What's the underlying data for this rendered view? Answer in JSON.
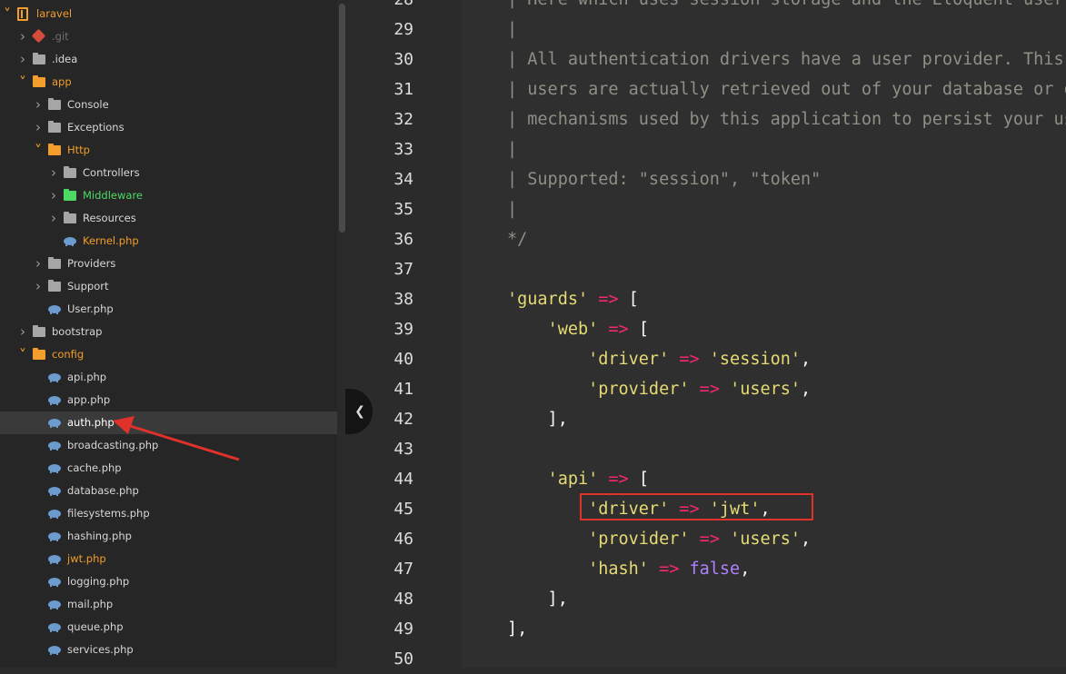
{
  "sidebar": {
    "items": [
      {
        "label": "laravel",
        "icon": "repo-icon",
        "depth": 0,
        "arrow": "open",
        "style": "orange"
      },
      {
        "label": ".git",
        "icon": "git-icon",
        "depth": 1,
        "arrow": "closed",
        "style": "dim"
      },
      {
        "label": ".idea",
        "icon": "folder-icon",
        "depth": 1,
        "arrow": "closed",
        "style": ""
      },
      {
        "label": "app",
        "icon": "folder-icon",
        "depth": 1,
        "arrow": "open",
        "style": "orange"
      },
      {
        "label": "Console",
        "icon": "folder-icon",
        "depth": 2,
        "arrow": "closed",
        "style": ""
      },
      {
        "label": "Exceptions",
        "icon": "folder-icon",
        "depth": 2,
        "arrow": "closed",
        "style": ""
      },
      {
        "label": "Http",
        "icon": "folder-icon",
        "depth": 2,
        "arrow": "open",
        "style": "orange"
      },
      {
        "label": "Controllers",
        "icon": "folder-icon",
        "depth": 3,
        "arrow": "closed",
        "style": ""
      },
      {
        "label": "Middleware",
        "icon": "folder-icon",
        "depth": 3,
        "arrow": "closed",
        "style": "green"
      },
      {
        "label": "Resources",
        "icon": "folder-icon",
        "depth": 3,
        "arrow": "closed",
        "style": ""
      },
      {
        "label": "Kernel.php",
        "icon": "php-file-icon",
        "depth": 3,
        "arrow": "none",
        "style": "orange"
      },
      {
        "label": "Providers",
        "icon": "folder-icon",
        "depth": 2,
        "arrow": "closed",
        "style": ""
      },
      {
        "label": "Support",
        "icon": "folder-icon",
        "depth": 2,
        "arrow": "closed",
        "style": ""
      },
      {
        "label": "User.php",
        "icon": "php-file-icon",
        "depth": 2,
        "arrow": "none",
        "style": ""
      },
      {
        "label": "bootstrap",
        "icon": "folder-icon",
        "depth": 1,
        "arrow": "closed",
        "style": ""
      },
      {
        "label": "config",
        "icon": "folder-icon",
        "depth": 1,
        "arrow": "open",
        "style": "orange"
      },
      {
        "label": "api.php",
        "icon": "php-file-icon",
        "depth": 2,
        "arrow": "none",
        "style": ""
      },
      {
        "label": "app.php",
        "icon": "php-file-icon",
        "depth": 2,
        "arrow": "none",
        "style": ""
      },
      {
        "label": "auth.php",
        "icon": "php-file-icon",
        "depth": 2,
        "arrow": "none",
        "style": "selected"
      },
      {
        "label": "broadcasting.php",
        "icon": "php-file-icon",
        "depth": 2,
        "arrow": "none",
        "style": ""
      },
      {
        "label": "cache.php",
        "icon": "php-file-icon",
        "depth": 2,
        "arrow": "none",
        "style": ""
      },
      {
        "label": "database.php",
        "icon": "php-file-icon",
        "depth": 2,
        "arrow": "none",
        "style": ""
      },
      {
        "label": "filesystems.php",
        "icon": "php-file-icon",
        "depth": 2,
        "arrow": "none",
        "style": ""
      },
      {
        "label": "hashing.php",
        "icon": "php-file-icon",
        "depth": 2,
        "arrow": "none",
        "style": ""
      },
      {
        "label": "jwt.php",
        "icon": "php-file-icon",
        "depth": 2,
        "arrow": "none",
        "style": "orange"
      },
      {
        "label": "logging.php",
        "icon": "php-file-icon",
        "depth": 2,
        "arrow": "none",
        "style": ""
      },
      {
        "label": "mail.php",
        "icon": "php-file-icon",
        "depth": 2,
        "arrow": "none",
        "style": ""
      },
      {
        "label": "queue.php",
        "icon": "php-file-icon",
        "depth": 2,
        "arrow": "none",
        "style": ""
      },
      {
        "label": "services.php",
        "icon": "php-file-icon",
        "depth": 2,
        "arrow": "none",
        "style": ""
      }
    ]
  },
  "editor": {
    "lines": [
      {
        "number": "28",
        "tokens": [
          [
            "comment",
            "| Here which uses session storage and the Eloquent user provider."
          ]
        ]
      },
      {
        "number": "29",
        "tokens": [
          [
            "comment",
            "|"
          ]
        ]
      },
      {
        "number": "30",
        "tokens": [
          [
            "comment",
            "| All authentication drivers have a user provider. This defines how the"
          ]
        ]
      },
      {
        "number": "31",
        "tokens": [
          [
            "comment",
            "| users are actually retrieved out of your database or other storage"
          ]
        ]
      },
      {
        "number": "32",
        "tokens": [
          [
            "comment",
            "| mechanisms used by this application to persist your user's data."
          ]
        ]
      },
      {
        "number": "33",
        "tokens": [
          [
            "comment",
            "|"
          ]
        ]
      },
      {
        "number": "34",
        "tokens": [
          [
            "comment",
            "| Supported: \"session\", \"token\""
          ]
        ]
      },
      {
        "number": "35",
        "tokens": [
          [
            "comment",
            "|"
          ]
        ]
      },
      {
        "number": "36",
        "tokens": [
          [
            "comment",
            "*/"
          ]
        ]
      },
      {
        "number": "37",
        "tokens": []
      },
      {
        "number": "38",
        "tokens": [
          [
            "string",
            "'guards'"
          ],
          [
            "punc",
            " "
          ],
          [
            "op",
            "=>"
          ],
          [
            "punc",
            " ["
          ]
        ]
      },
      {
        "number": "39",
        "tokens": [
          [
            "punc",
            "    "
          ],
          [
            "string",
            "'web'"
          ],
          [
            "punc",
            " "
          ],
          [
            "op",
            "=>"
          ],
          [
            "punc",
            " ["
          ]
        ]
      },
      {
        "number": "40",
        "tokens": [
          [
            "punc",
            "        "
          ],
          [
            "string",
            "'driver'"
          ],
          [
            "punc",
            " "
          ],
          [
            "op",
            "=>"
          ],
          [
            "punc",
            " "
          ],
          [
            "string",
            "'session'"
          ],
          [
            "punc",
            ","
          ]
        ]
      },
      {
        "number": "41",
        "tokens": [
          [
            "punc",
            "        "
          ],
          [
            "string",
            "'provider'"
          ],
          [
            "punc",
            " "
          ],
          [
            "op",
            "=>"
          ],
          [
            "punc",
            " "
          ],
          [
            "string",
            "'users'"
          ],
          [
            "punc",
            ","
          ]
        ]
      },
      {
        "number": "42",
        "tokens": [
          [
            "punc",
            "    ],"
          ]
        ]
      },
      {
        "number": "43",
        "tokens": []
      },
      {
        "number": "44",
        "tokens": [
          [
            "punc",
            "    "
          ],
          [
            "string",
            "'api'"
          ],
          [
            "punc",
            " "
          ],
          [
            "op",
            "=>"
          ],
          [
            "punc",
            " ["
          ]
        ]
      },
      {
        "number": "45",
        "tokens": [
          [
            "punc",
            "        "
          ],
          [
            "string",
            "'driver'"
          ],
          [
            "punc",
            " "
          ],
          [
            "op",
            "=>"
          ],
          [
            "punc",
            " "
          ],
          [
            "string",
            "'jwt'"
          ],
          [
            "punc",
            ","
          ]
        ]
      },
      {
        "number": "46",
        "tokens": [
          [
            "punc",
            "        "
          ],
          [
            "string",
            "'provider'"
          ],
          [
            "punc",
            " "
          ],
          [
            "op",
            "=>"
          ],
          [
            "punc",
            " "
          ],
          [
            "string",
            "'users'"
          ],
          [
            "punc",
            ","
          ]
        ]
      },
      {
        "number": "47",
        "tokens": [
          [
            "punc",
            "        "
          ],
          [
            "string",
            "'hash'"
          ],
          [
            "punc",
            " "
          ],
          [
            "op",
            "=>"
          ],
          [
            "punc",
            " "
          ],
          [
            "const",
            "false"
          ],
          [
            "punc",
            ","
          ]
        ]
      },
      {
        "number": "48",
        "tokens": [
          [
            "punc",
            "    ],"
          ]
        ]
      },
      {
        "number": "49",
        "tokens": [
          [
            "punc",
            "],"
          ]
        ]
      },
      {
        "number": "50",
        "tokens": []
      }
    ],
    "highlighted_line": "45"
  },
  "colors": {
    "accent_orange": "#f29d2c",
    "accent_green": "#4cd964",
    "annotation_red": "#e0312b",
    "string": "#e6db74",
    "operator": "#f92672",
    "constant": "#ae81ff",
    "comment": "#8f8f85"
  },
  "icons": {
    "collapse": "chevron-left-icon",
    "folder": "folder-icon",
    "php_file": "php-file-icon",
    "repo": "repo-icon",
    "git": "git-icon"
  }
}
